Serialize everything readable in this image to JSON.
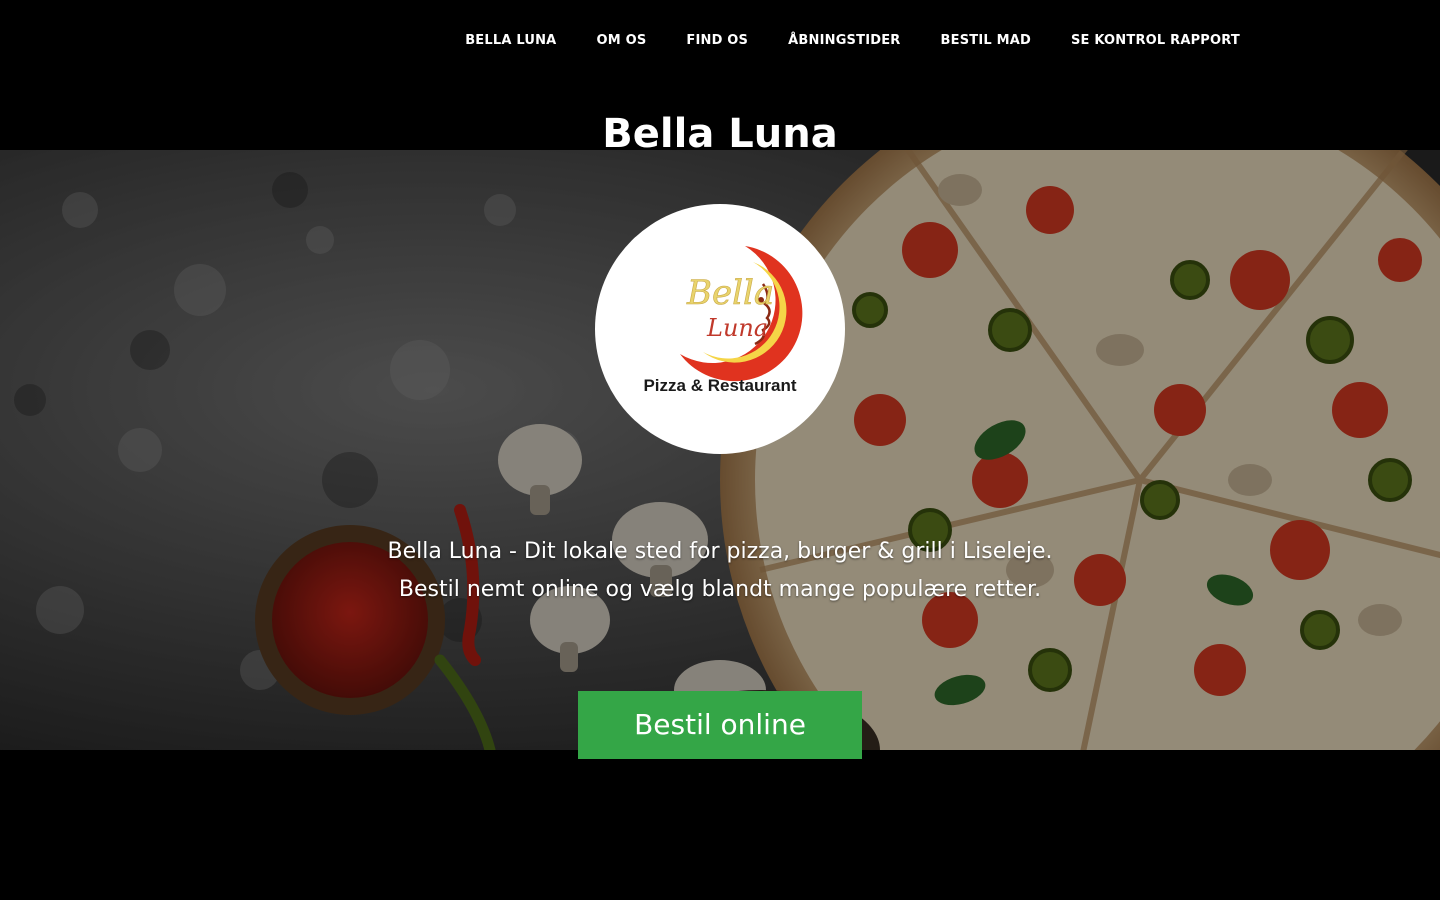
{
  "nav": {
    "items": [
      {
        "label": "BELLA LUNA"
      },
      {
        "label": "OM OS"
      },
      {
        "label": "FIND OS"
      },
      {
        "label": "ÅBNINGSTIDER"
      },
      {
        "label": "BESTIL MAD"
      },
      {
        "label": "SE KONTROL RAPPORT"
      }
    ]
  },
  "site_title": "Bella Luna",
  "logo": {
    "script_line1": "Bella",
    "script_line2": "Luna",
    "subtitle": "Pizza & Restaurant"
  },
  "hero": {
    "tagline_line1": "Bella Luna - Dit lokale sted for pizza, burger & grill i Liseleje.",
    "tagline_line2": "Bestil nemt online og vælg blandt mange populære retter.",
    "cta_label": "Bestil online"
  },
  "colors": {
    "background": "#000000",
    "cta": "#34a647",
    "logo_red": "#e0331f",
    "logo_yellow": "#f5d547",
    "text": "#ffffff"
  }
}
